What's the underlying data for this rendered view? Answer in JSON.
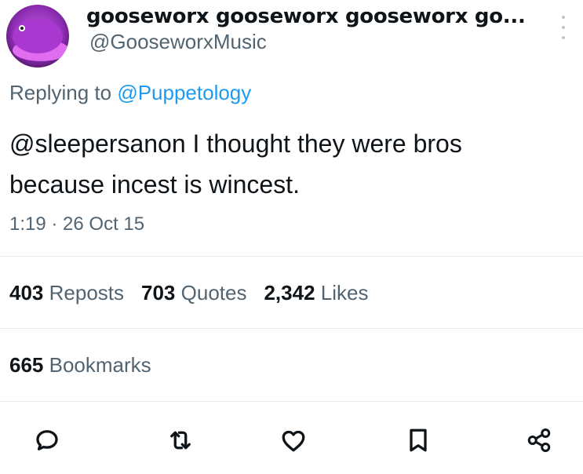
{
  "user": {
    "display_name": "gooseworx gooseworx gooseworx go...",
    "handle": "@GooseworxMusic",
    "avatar_icon": "purple-creature-avatar"
  },
  "reply": {
    "prefix": "Replying to ",
    "mention": "@Puppetology"
  },
  "tweet": {
    "text_line1": "@sleepersanon I thought they were bros",
    "text_line2": "because incest is wincest.",
    "timestamp": "1:19 · 26 Oct 15"
  },
  "stats": {
    "reposts_count": "403",
    "reposts_label": "Reposts",
    "quotes_count": "703",
    "quotes_label": "Quotes",
    "likes_count": "2,342",
    "likes_label": "Likes",
    "bookmarks_count": "665",
    "bookmarks_label": "Bookmarks"
  },
  "actions": [
    "reply-icon",
    "repost-icon",
    "like-icon",
    "bookmark-icon",
    "share-icon"
  ],
  "colors": {
    "text": "#0f1419",
    "muted": "#536471",
    "link": "#1d9bf0",
    "divider": "#e6ebee"
  }
}
